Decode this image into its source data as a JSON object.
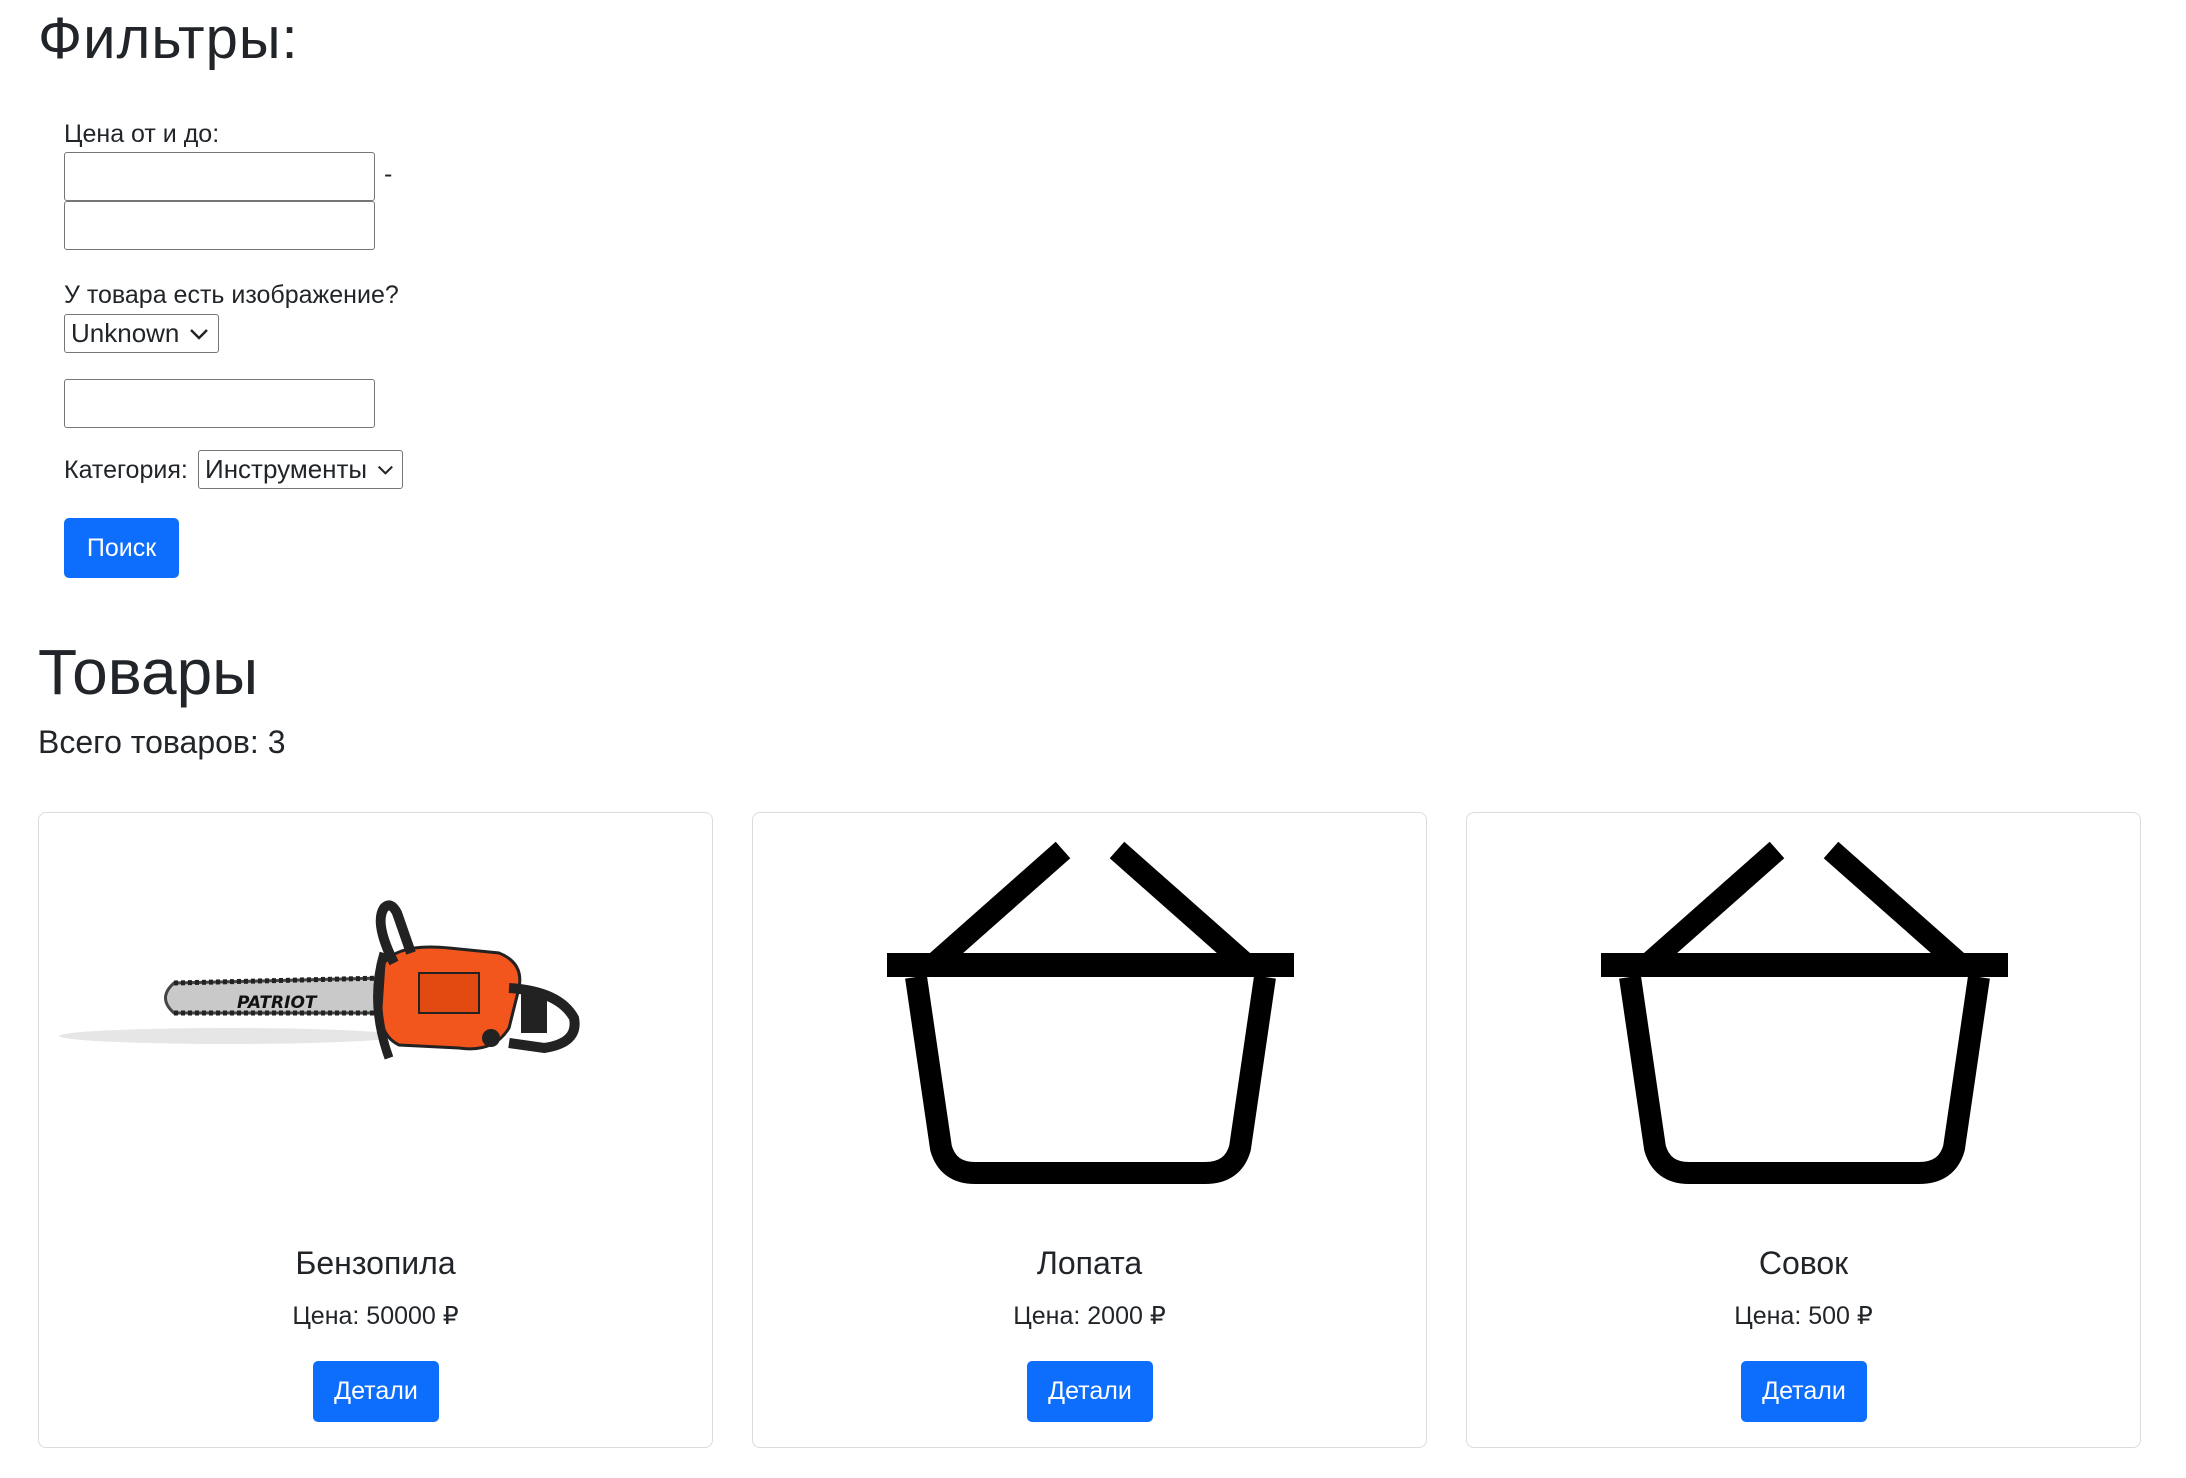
{
  "filters": {
    "title": "Фильтры:",
    "price_label": "Цена от и до:",
    "price_separator": "-",
    "price_from_value": "",
    "price_to_value": "",
    "has_image_label": "У товара есть изображение?",
    "has_image_selected": "Unknown",
    "name_value": "",
    "category_label": "Категория:",
    "category_selected": "Инструменты",
    "search_button": "Поиск"
  },
  "products": {
    "title": "Товары",
    "total_label": "Всего товаров: 3",
    "items": [
      {
        "name": "Бензопила",
        "price": "Цена: 50000 ₽",
        "button": "Детали",
        "image": "chainsaw-image",
        "image_text": "PATRIOT"
      },
      {
        "name": "Лопата",
        "price": "Цена: 2000 ₽",
        "button": "Детали",
        "image": "basket-icon"
      },
      {
        "name": "Совок",
        "price": "Цена: 500 ₽",
        "button": "Детали",
        "image": "basket-icon"
      }
    ]
  },
  "colors": {
    "primary": "#0d6efd",
    "text": "#212529",
    "chainsaw_body": "#f2561d"
  }
}
